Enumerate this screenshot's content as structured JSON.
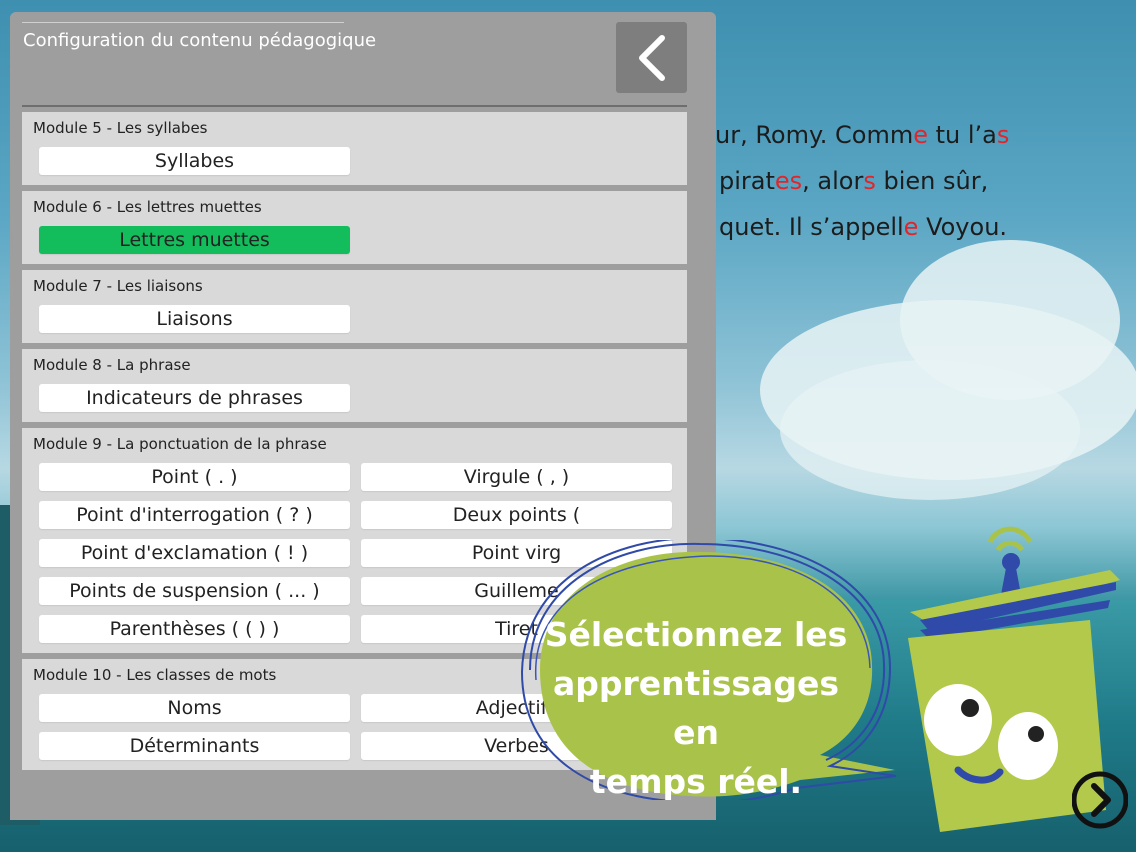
{
  "panel": {
    "title": "Configuration du contenu pédagogique",
    "back_icon": "chevron-left-icon"
  },
  "modules": [
    {
      "title": "Module 5 - Les syllabes",
      "items": [
        {
          "label": "Syllabes",
          "selected": false
        }
      ]
    },
    {
      "title": "Module 6 - Les lettres muettes",
      "items": [
        {
          "label": "Lettres muettes",
          "selected": true
        }
      ]
    },
    {
      "title": "Module 7 - Les liaisons",
      "items": [
        {
          "label": "Liaisons",
          "selected": false
        }
      ]
    },
    {
      "title": "Module 8 - La phrase",
      "items": [
        {
          "label": "Indicateurs de phrases",
          "selected": false
        }
      ]
    },
    {
      "title": "Module 9 - La ponctuation de la phrase",
      "items": [
        {
          "label": "Point ( . )",
          "selected": false
        },
        {
          "label": "Virgule ( , )",
          "selected": false
        },
        {
          "label": "Point d'interrogation ( ? )",
          "selected": false
        },
        {
          "label": "Deux points (",
          "selected": false
        },
        {
          "label": "Point d'exclamation ( ! )",
          "selected": false
        },
        {
          "label": "Point virg",
          "selected": false
        },
        {
          "label": "Points de suspension ( ... )",
          "selected": false
        },
        {
          "label": "Guilleme",
          "selected": false
        },
        {
          "label": "Parenthèses ( ( ) )",
          "selected": false
        },
        {
          "label": "Tiret",
          "selected": false
        }
      ]
    },
    {
      "title": "Module 10 - Les classes de mots",
      "items": [
        {
          "label": "Noms",
          "selected": false
        },
        {
          "label": "Adjectifs",
          "selected": false
        },
        {
          "label": "Déterminants",
          "selected": false
        },
        {
          "label": "Verbes",
          "selected": false
        }
      ]
    }
  ],
  "story": {
    "line1": [
      {
        "t": "ur, Romy. Comm",
        "red": false
      },
      {
        "t": "e",
        "red": true
      },
      {
        "t": " tu l’a",
        "red": false
      },
      {
        "t": "s",
        "red": true
      }
    ],
    "line2": [
      {
        "t": "pirat",
        "red": false
      },
      {
        "t": "es",
        "red": true
      },
      {
        "t": ", alor",
        "red": false
      },
      {
        "t": "s",
        "red": true
      },
      {
        "t": " bien sûr,",
        "red": false
      }
    ],
    "line3": [
      {
        "t": "quet. Il s’appell",
        "red": false
      },
      {
        "t": "e",
        "red": true
      },
      {
        "t": " Voyou.",
        "red": false
      }
    ]
  },
  "promo": {
    "line1": "Sélectionnez les",
    "line2": "apprentissages en",
    "line3": "temps réel."
  },
  "colors": {
    "selected": "#13bd5b",
    "bubble": "#a9c34a",
    "mascot": "#b3c94b"
  },
  "icons": {
    "mascot": "book-robot-mascot",
    "next": "chevron-right-circle-icon"
  }
}
